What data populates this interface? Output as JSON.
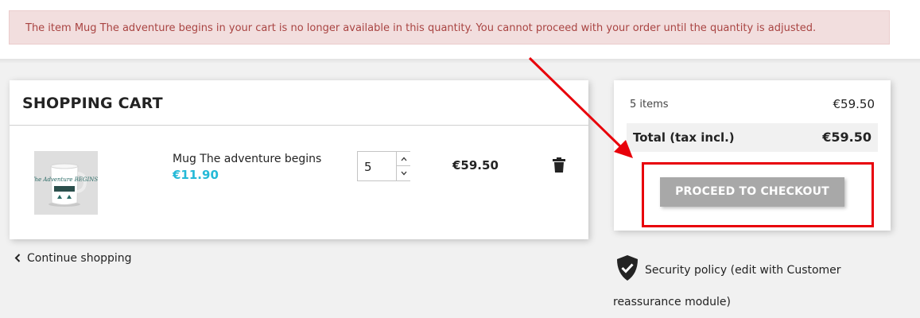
{
  "alert": {
    "message": "The item Mug The adventure begins in your cart is no longer available in this quantity. You cannot proceed with your order until the quantity is adjusted.",
    "color": "#a94442",
    "background": "#f2dede"
  },
  "cart": {
    "title": "SHOPPING CART",
    "items": [
      {
        "name": "Mug The adventure begins",
        "unit_price": "€11.90",
        "quantity": "5",
        "line_total": "€59.50",
        "image_icon": "mug-image",
        "image_text": "The Adventure BEGINS"
      }
    ]
  },
  "continue_shopping": {
    "label": "Continue shopping",
    "icon": "chevron-left-icon"
  },
  "summary": {
    "items_label": "5 items",
    "items_price": "€59.50",
    "total_label": "Total (tax incl.)",
    "total_value": "€59.50",
    "checkout_label": "PROCEED TO CHECKOUT",
    "checkout_state": "disabled"
  },
  "reassurance": {
    "icon": "shield-check-icon",
    "text": "Security policy (edit with Customer reassurance module)"
  },
  "colors": {
    "accent": "#24b9d7",
    "annotation_red": "#e8000a",
    "checkout_disabled": "#a8a8a8"
  }
}
